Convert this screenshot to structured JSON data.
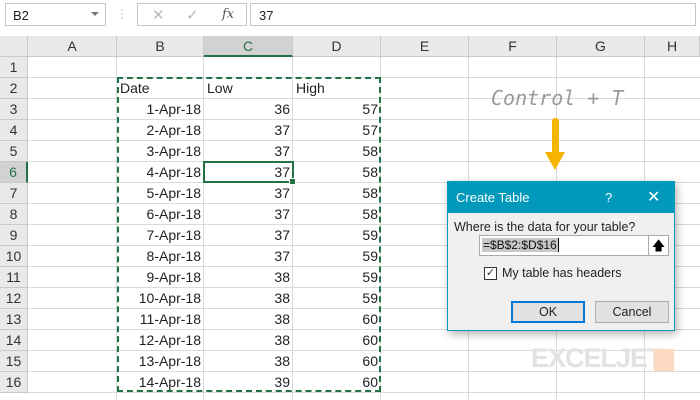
{
  "formula_bar": {
    "name_box": "B2",
    "formula": "37",
    "cancel_icon": "✕",
    "enter_icon": "✓",
    "fx_icon": "fx"
  },
  "columns": [
    "A",
    "B",
    "C",
    "D",
    "E",
    "F",
    "G",
    "H"
  ],
  "rows": [
    "1",
    "2",
    "3",
    "4",
    "5",
    "6",
    "7",
    "8",
    "9",
    "10",
    "11",
    "12",
    "13",
    "14",
    "15",
    "16"
  ],
  "headers": {
    "date": "Date",
    "low": "Low",
    "high": "High"
  },
  "data": [
    [
      "1-Apr-18",
      "36",
      "57"
    ],
    [
      "2-Apr-18",
      "37",
      "57"
    ],
    [
      "3-Apr-18",
      "37",
      "58"
    ],
    [
      "4-Apr-18",
      "37",
      "58"
    ],
    [
      "5-Apr-18",
      "37",
      "58"
    ],
    [
      "6-Apr-18",
      "37",
      "58"
    ],
    [
      "7-Apr-18",
      "37",
      "59"
    ],
    [
      "8-Apr-18",
      "37",
      "59"
    ],
    [
      "9-Apr-18",
      "38",
      "59"
    ],
    [
      "10-Apr-18",
      "38",
      "59"
    ],
    [
      "11-Apr-18",
      "38",
      "60"
    ],
    [
      "12-Apr-18",
      "38",
      "60"
    ],
    [
      "13-Apr-18",
      "38",
      "60"
    ],
    [
      "14-Apr-18",
      "39",
      "60"
    ]
  ],
  "annotation": "Control + T",
  "dialog": {
    "title": "Create Table",
    "help": "?",
    "close": "✕",
    "prompt": "Where is the data for your table?",
    "range": "=$B$2:$D$16",
    "collapse_icon": "🡅",
    "checkbox_label": "My table has headers",
    "checked": true,
    "ok": "OK",
    "cancel": "Cancel"
  },
  "logo": "EXCELJET",
  "colors": {
    "accent": "#217346",
    "dialog_title": "#0099bc",
    "arrow": "#f4b400"
  }
}
